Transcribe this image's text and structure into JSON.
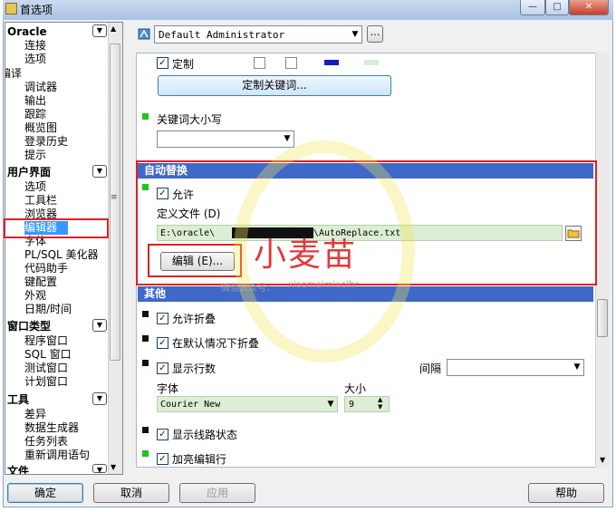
{
  "window": {
    "title": "首选项",
    "minimize": "—",
    "maximize": "□",
    "close": "✕"
  },
  "tree": {
    "categories": [
      {
        "label": "Oracle",
        "toggle": "▼",
        "items": [
          "连接",
          "选项"
        ]
      },
      {
        "label": "编译",
        "items": [
          "调试器",
          "输出",
          "跟踪",
          "概览图",
          "登录历史",
          "提示"
        ]
      },
      {
        "label": "用户界面",
        "toggle": "▼",
        "items": [
          "选项",
          "工具栏",
          "浏览器",
          "编辑器",
          "字体",
          "PL/SQL 美化器",
          "代码助手",
          "键配置",
          "外观",
          "日期/时间"
        ],
        "selected": "编辑器"
      },
      {
        "label": "窗口类型",
        "toggle": "▼",
        "items": [
          "程序窗口",
          "SQL 窗口",
          "测试窗口",
          "计划窗口"
        ]
      },
      {
        "label": "工具",
        "toggle": "▼",
        "items": [
          "差异",
          "数据生成器",
          "任务列表",
          "重新调用语句"
        ]
      },
      {
        "label": "文件",
        "toggle": "▼",
        "items": []
      }
    ]
  },
  "profile": {
    "value": "Default Administrator",
    "more": "…"
  },
  "custom": {
    "checkbox_label": "定制",
    "button": "定制关键词..."
  },
  "keyword_case": {
    "label": "关键词大小写",
    "value": ""
  },
  "autoreplace": {
    "header": "自动替换",
    "enable_label": "允许",
    "file_label": "定义文件 (D)",
    "file_path_prefix": "E:\\oracle\\",
    "file_path_suffix": "\\AutoReplace.txt",
    "edit_button": "编辑 (E)..."
  },
  "other": {
    "header": "其他",
    "fold_label": "允许折叠",
    "fold_default_label": "在默认情况下折叠",
    "line_numbers_label": "显示行数",
    "interval_label": "间隔",
    "interval_value": "",
    "font_label": "字体",
    "size_label": "大小",
    "font_value": "Courier New",
    "size_value": "9",
    "line_state_label": "显示线路状态",
    "highlight_label": "加亮编辑行"
  },
  "watermark": {
    "text": "小麦苗",
    "sub": "微信公众号：",
    "sub2": "xiaomaimiaolhr"
  },
  "buttons": {
    "ok": "确定",
    "cancel": "取消",
    "apply": "应用",
    "help": "帮助"
  },
  "colors": {
    "section_header": "#3f68c8",
    "selection": "#3399ff",
    "highlight_box": "#e02020",
    "file_field": "#dcefd5"
  }
}
